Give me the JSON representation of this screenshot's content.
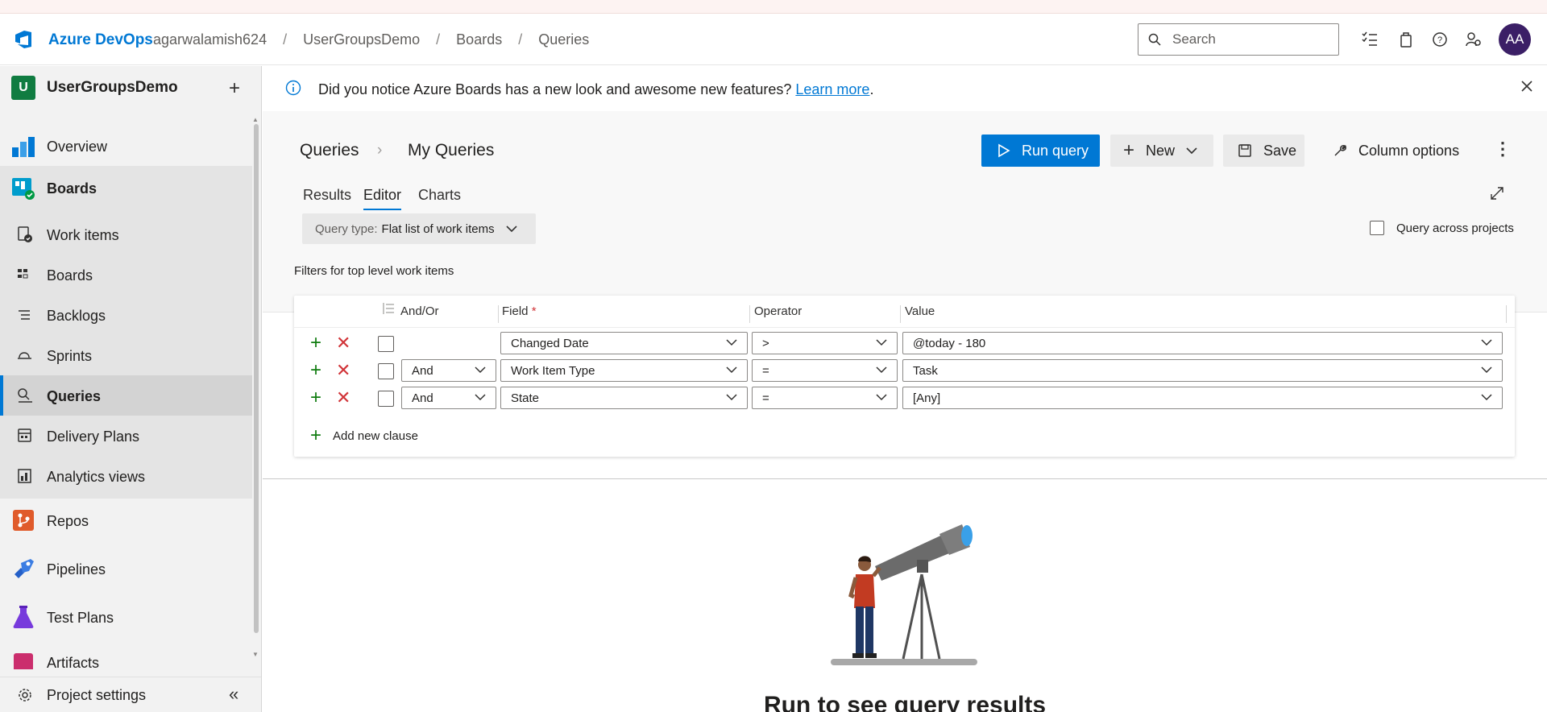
{
  "header": {
    "brand": "Azure DevOps",
    "breadcrumb": [
      "agarwalamish624",
      "UserGroupsDemo",
      "Boards",
      "Queries"
    ],
    "search_placeholder": "Search",
    "avatar_initials": "AA"
  },
  "sidebar": {
    "project_initial": "U",
    "project_name": "UserGroupsDemo",
    "items": [
      {
        "label": "Overview",
        "icon": "overview-icon",
        "color": "#0078d4"
      },
      {
        "label": "Boards",
        "icon": "boards-hub-icon",
        "color": "#009ccc"
      },
      {
        "label": "Work items",
        "icon": "work-items-icon"
      },
      {
        "label": "Boards",
        "icon": "boards-icon"
      },
      {
        "label": "Backlogs",
        "icon": "backlogs-icon"
      },
      {
        "label": "Sprints",
        "icon": "sprints-icon"
      },
      {
        "label": "Queries",
        "icon": "queries-icon"
      },
      {
        "label": "Delivery Plans",
        "icon": "delivery-plans-icon"
      },
      {
        "label": "Analytics views",
        "icon": "analytics-icon"
      },
      {
        "label": "Repos",
        "icon": "repos-icon",
        "color": "#e05b2b"
      },
      {
        "label": "Pipelines",
        "icon": "pipelines-icon",
        "color": "#3b7de3"
      },
      {
        "label": "Test Plans",
        "icon": "test-plans-icon",
        "color": "#773adc"
      },
      {
        "label": "Artifacts",
        "icon": "artifacts-icon",
        "color": "#cb2e6d"
      }
    ],
    "settings_label": "Project settings"
  },
  "banner": {
    "message": "Did you notice Azure Boards has a new look and awesome new features?",
    "link": "Learn more",
    "end": "."
  },
  "page": {
    "crumb_root": "Queries",
    "crumb_current": "My Queries",
    "run_query": "Run query",
    "new": "New",
    "save": "Save",
    "column_options": "Column options",
    "tabs": [
      "Results",
      "Editor",
      "Charts"
    ],
    "active_tab": "Editor",
    "query_type_label": "Query type:",
    "query_type_value": "Flat list of work items",
    "query_across_projects": "Query across projects"
  },
  "editor": {
    "filters_title": "Filters for top level work items",
    "columns": {
      "and_or": "And/Or",
      "field": "Field",
      "required_mark": "*",
      "operator": "Operator",
      "value": "Value"
    },
    "clauses": [
      {
        "and_or": "",
        "field": "Changed Date",
        "operator": ">",
        "value": "@today - 180"
      },
      {
        "and_or": "And",
        "field": "Work Item Type",
        "operator": "=",
        "value": "Task"
      },
      {
        "and_or": "And",
        "field": "State",
        "operator": "=",
        "value": "[Any]"
      }
    ],
    "add_clause": "Add new clause"
  },
  "results": {
    "empty_message": "Run to see query results"
  },
  "colors": {
    "accent": "#0078d4",
    "add_green": "#107c10",
    "delete_red": "#d13438"
  }
}
